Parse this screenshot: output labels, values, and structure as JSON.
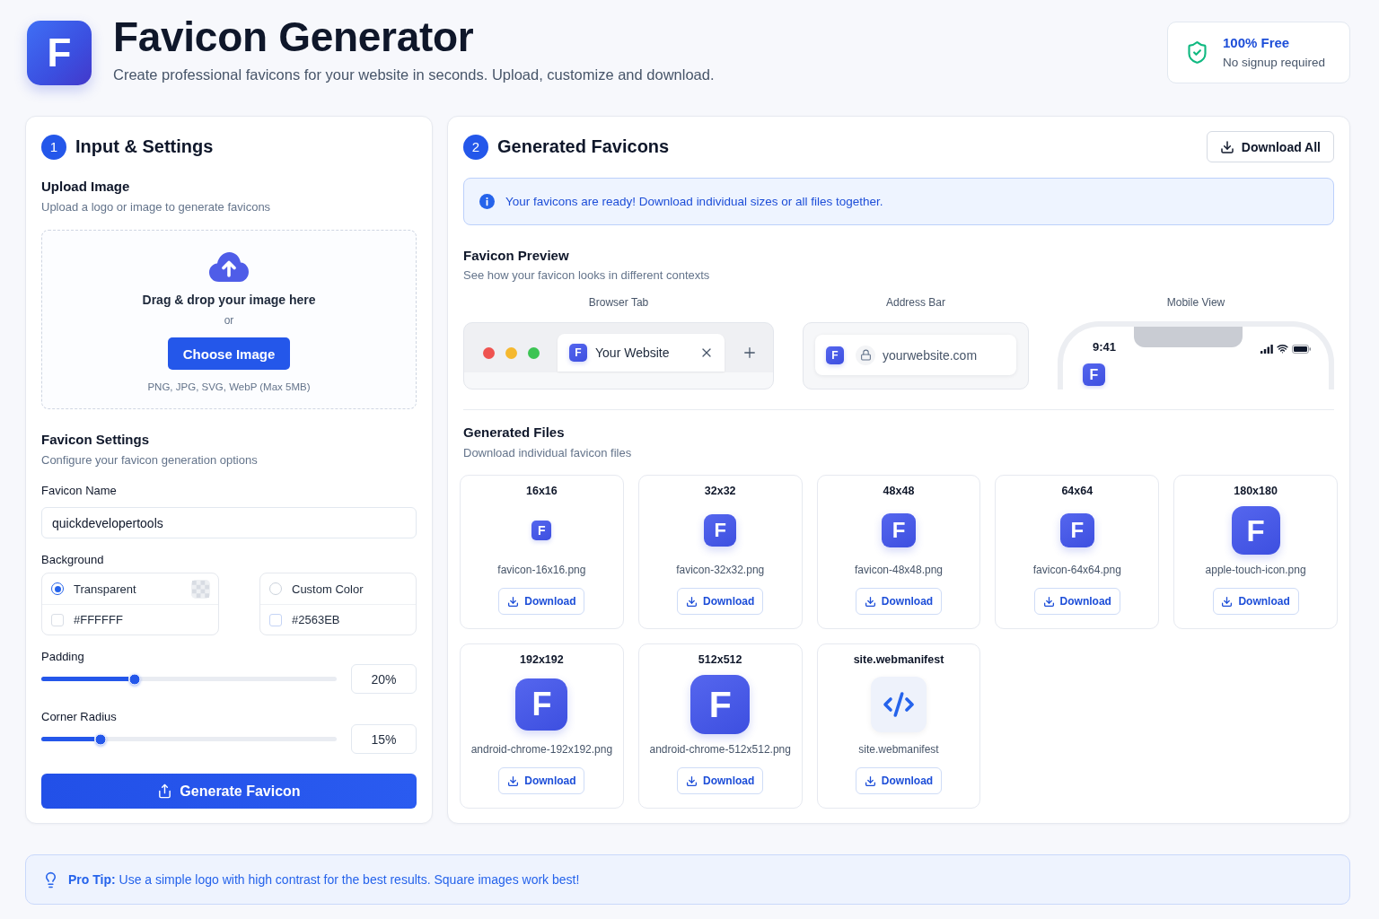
{
  "header": {
    "logo_letter": "F",
    "title": "Favicon Generator",
    "subtitle": "Create professional favicons for your website in seconds. Upload, customize and download.",
    "badge": {
      "title": "100% Free",
      "subtitle": "No signup required"
    }
  },
  "input_panel": {
    "step": "1",
    "title": "Input & Settings",
    "upload": {
      "title": "Upload Image",
      "subtitle": "Upload a logo or image to generate favicons",
      "drop_text": "Drag & drop your image here",
      "or_text": "or",
      "button": "Choose Image",
      "formats": "PNG, JPG, SVG, WebP (Max 5MB)"
    },
    "settings": {
      "title": "Favicon Settings",
      "subtitle": "Configure your favicon generation options",
      "name_field": {
        "label": "Favicon Name",
        "value": "quickdevelopertools"
      },
      "background": {
        "label": "Background",
        "options": [
          {
            "kind": "transparent",
            "label": "Transparent",
            "selected": true,
            "hex_option": {
              "label": "#FFFFFF",
              "checked": false
            }
          },
          {
            "kind": "custom",
            "label": "Custom Color",
            "selected": false,
            "hex_option": {
              "label": "#2563EB",
              "checked": false
            }
          }
        ]
      },
      "sliders": [
        {
          "label": "Padding",
          "level": 0.315,
          "reading": "20%"
        },
        {
          "label": "Corner Radius",
          "level": 0.2,
          "reading": "15%"
        }
      ]
    },
    "generate_button": "Generate Favicon"
  },
  "output_panel": {
    "step": "2",
    "title": "Generated Favicons",
    "download_all": "Download All",
    "notice": "Your favicons are ready! Download individual sizes or all files together.",
    "preview": {
      "title": "Favicon Preview",
      "subtitle": "See how your favicon looks in different contexts",
      "contexts": [
        {
          "kind": "browser_tab",
          "label": "Browser Tab",
          "letter": "F",
          "tab_title": "Your Website"
        },
        {
          "kind": "address_bar",
          "label": "Address Bar",
          "letter": "F",
          "url": "yourwebsite.com"
        },
        {
          "kind": "mobile",
          "label": "Mobile View",
          "time": "9:41",
          "letter": "F"
        }
      ]
    },
    "files": {
      "title": "Generated Files",
      "subtitle": "Download individual favicon files",
      "items": [
        {
          "kind": "image",
          "size": "16x16",
          "letter": "F",
          "filename": "favicon-16x16.png",
          "button": "Download"
        },
        {
          "kind": "image",
          "size": "32x32",
          "letter": "F",
          "filename": "favicon-32x32.png",
          "button": "Download"
        },
        {
          "kind": "image",
          "size": "48x48",
          "letter": "F",
          "filename": "favicon-48x48.png",
          "button": "Download"
        },
        {
          "kind": "image",
          "size": "64x64",
          "letter": "F",
          "filename": "favicon-64x64.png",
          "button": "Download"
        },
        {
          "kind": "image",
          "size": "180x180",
          "letter": "F",
          "filename": "apple-touch-icon.png",
          "button": "Download"
        },
        {
          "kind": "image",
          "size": "192x192",
          "letter": "F",
          "filename": "android-chrome-192x192.png",
          "button": "Download"
        },
        {
          "kind": "image",
          "size": "512x512",
          "letter": "F",
          "filename": "android-chrome-512x512.png",
          "button": "Download"
        },
        {
          "kind": "manifest",
          "size": "site.webmanifest",
          "filename": "site.webmanifest",
          "button": "Download"
        }
      ]
    }
  },
  "tip": {
    "text": "**Pro Tip:** Use a simple logo with high contrast for the best results. Square images work best!"
  }
}
